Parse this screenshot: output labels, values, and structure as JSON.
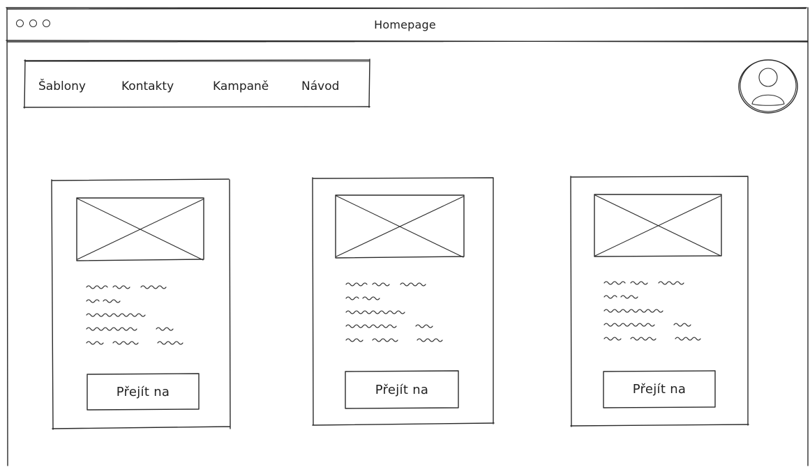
{
  "window": {
    "title": "Homepage"
  },
  "nav": {
    "items": [
      {
        "label": "Šablony"
      },
      {
        "label": "Kontakty"
      },
      {
        "label": "Kampaně"
      },
      {
        "label": "Návod"
      }
    ]
  },
  "avatar": {
    "icon": "user-avatar-icon"
  },
  "cards": [
    {
      "image_icon": "image-placeholder-icon",
      "button_label": "Přejít na"
    },
    {
      "image_icon": "image-placeholder-icon",
      "button_label": "Přejít na"
    },
    {
      "image_icon": "image-placeholder-icon",
      "button_label": "Přejít na"
    }
  ],
  "colors": {
    "stroke": "#2a2a2a",
    "background": "#ffffff"
  }
}
